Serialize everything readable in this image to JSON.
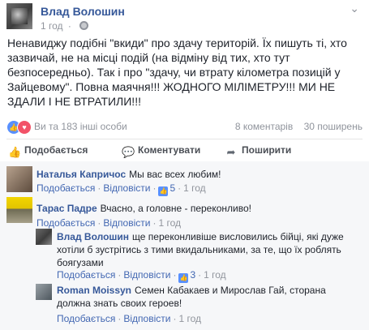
{
  "post": {
    "author": "Влад Волошин",
    "time": "1 год",
    "text": "Ненавиджу подібні \"вкиди\" про здачу територій. Їх пишуть ті, хто зазвичай, не на місці подій (на відміну від тих, хто тут безпосередньо). Так і про \"здачу, чи втрату кілометра позицій у Зайцевому\". Повна маячня!!! ЖОДНОГО МІЛІМЕТРУ!!! МИ НЕ ЗДАЛИ І НЕ ВТРАТИЛИ!!!",
    "more_icon": "chevron-down-icon"
  },
  "reactions": {
    "text": "Ви та 183 інші особи",
    "comments_count": "8 коментарів",
    "shares_count": "30 поширень",
    "icons": [
      "like-icon",
      "love-icon"
    ]
  },
  "actions": {
    "like": "Подобається",
    "comment": "Коментувати",
    "share": "Поширити"
  },
  "comments": [
    {
      "author": "Наталья Капричос",
      "text": "Мы вас всех любим!",
      "like_label": "Подобається",
      "reply_label": "Відповісти",
      "likes": "5",
      "time": "1 год"
    },
    {
      "author": "Тарас Падре",
      "text": "Вчасно, а головне - переконливо!",
      "like_label": "Подобається",
      "reply_label": "Відповісти",
      "time": "1 год"
    },
    {
      "author": "Влад Волошин",
      "text_line1": "ще переконливіше висловились бійці, які дуже",
      "text_line2": "хотіли б зустрітись з тими вкидальниками, за те, що їх роблять",
      "text_line3": "боягузами",
      "like_label": "Подобається",
      "reply_label": "Відповісти",
      "likes": "3",
      "time": "1 год"
    },
    {
      "author": "Roman Moissyn",
      "text_line1": "Семен Кабакаев и Мирослав Гай, сторана",
      "text_line2": "должна знать своих героев!",
      "like_label": "Подобається",
      "reply_label": "Відповісти",
      "time": "1 год"
    }
  ]
}
